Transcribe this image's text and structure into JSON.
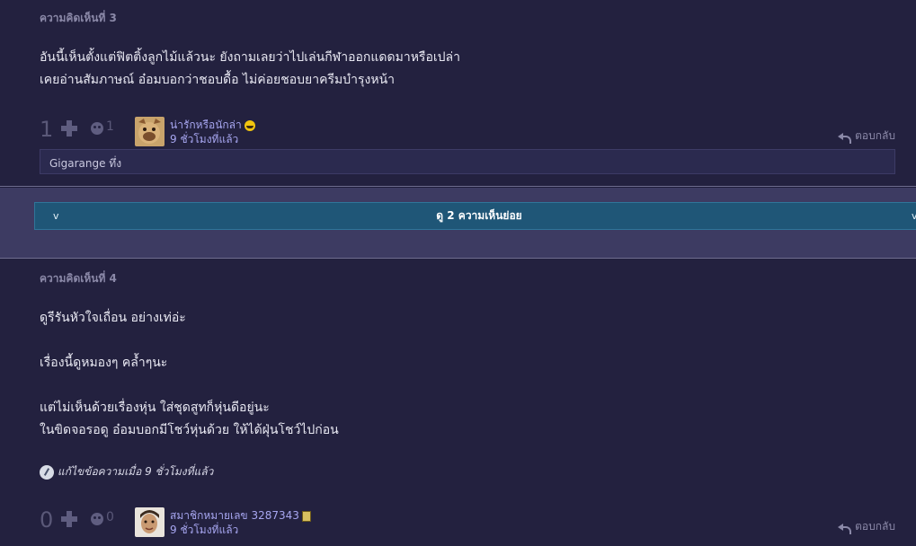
{
  "comment3": {
    "header": "ความคิดเห็นที่ 3",
    "body": "อันนี้เห็นตั้งแต่ฟิตติ้งลูกไม้แล้วนะ ยังถามเลยว่าไปเล่นกีฬาออกแดดมาหรือเปล่า\nเคยอ่านสัมภาษณ์ อ๋อมบอกว่าชอบดื้อ ไม่ค่อยชอบยาครีมบำรุงหน้า",
    "votes": "1",
    "emotion_count": "1",
    "user_name": "น่ารักหรือนักล่า",
    "time": "9 ชั่วโมงที่แล้ว",
    "reply": "ตอบกลับ",
    "tag": "Gigarange ทึ่ง"
  },
  "expand_label": "ดู 2 ความเห็นย่อย",
  "chevrons": {
    "left": "v",
    "right": "v"
  },
  "comment4": {
    "header": "ความคิดเห็นที่ 4",
    "body_paragraphs": [
      "ดูรีรันหัวใจเถื่อน อย่างเท่อ่ะ",
      "เรื่องนี้ดูหมองๆ คล้ำๆนะ",
      "แต่ไม่เห็นด้วยเรื่องหุ่น ใส่ชุดสูทก็หุ่นดีอยู่นะ\nในขิดจอรอดู อ๋อมบอกมีโชว์หุ่นด้วย ให้ได้ฝุ่นโชว์ไปก่อน"
    ],
    "edit_note": "แก้ไขข้อความเมื่อ 9 ชั่วโมงที่แล้ว",
    "votes": "0",
    "emotion_count": "0",
    "user_name": "สมาชิกหมายเลข 3287343",
    "time": "9 ชั่วโมงที่แล้ว",
    "reply": "ตอบกลับ"
  }
}
